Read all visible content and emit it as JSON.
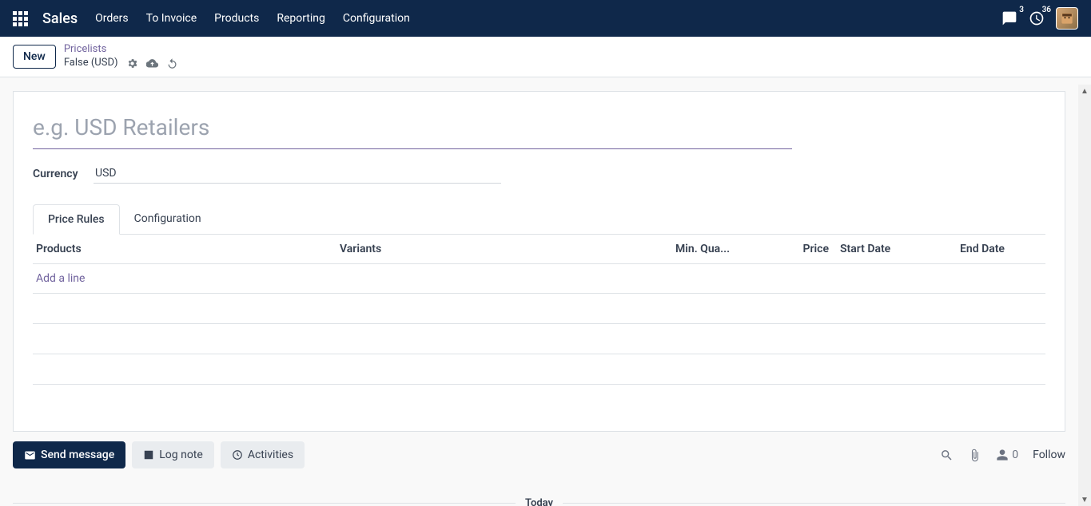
{
  "nav": {
    "brand": "Sales",
    "items": [
      "Orders",
      "To Invoice",
      "Products",
      "Reporting",
      "Configuration"
    ],
    "messages_count": "3",
    "activities_count": "36"
  },
  "controls": {
    "new_label": "New",
    "breadcrumb_parent": "Pricelists",
    "breadcrumb_current": "False (USD)"
  },
  "form": {
    "name_placeholder": "e.g. USD Retailers",
    "currency_label": "Currency",
    "currency_value": "USD"
  },
  "tabs": {
    "price_rules": "Price Rules",
    "configuration": "Configuration"
  },
  "table": {
    "columns": {
      "products": "Products",
      "variants": "Variants",
      "min_quantity": "Min. Qua...",
      "price": "Price",
      "start_date": "Start Date",
      "end_date": "End Date"
    },
    "add_line": "Add a line"
  },
  "chatter": {
    "send_message": "Send message",
    "log_note": "Log note",
    "activities": "Activities",
    "follower_count": "0",
    "follow": "Follow",
    "today": "Today"
  }
}
